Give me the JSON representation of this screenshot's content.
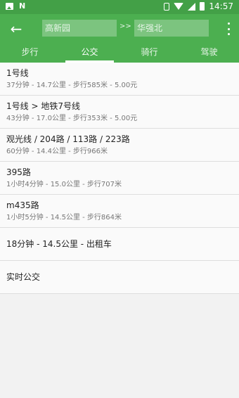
{
  "status_bar": {
    "time": "14:57",
    "icons": [
      "image-icon",
      "n-icon",
      "vibrate-icon",
      "wifi-icon",
      "signal-icon",
      "battery-icon"
    ]
  },
  "toolbar": {
    "from_value": "高新园",
    "arrows": ">>",
    "to_value": "华强北"
  },
  "tabs": [
    {
      "label": "步行",
      "active": false
    },
    {
      "label": "公交",
      "active": true
    },
    {
      "label": "骑行",
      "active": false
    },
    {
      "label": "驾驶",
      "active": false
    }
  ],
  "routes": [
    {
      "title": "1号线",
      "detail": "37分钟 - 14.7公里 - 步行585米 - 5.00元"
    },
    {
      "title": "1号线 > 地铁7号线",
      "detail": "43分钟 - 17.0公里 - 步行353米 - 5.00元"
    },
    {
      "title": "观光线 / 204路 / 113路 / 223路",
      "detail": "60分钟 - 14.4公里 - 步行966米"
    },
    {
      "title": "395路",
      "detail": "1小时4分钟 - 15.0公里 - 步行707米"
    },
    {
      "title": "m435路",
      "detail": "1小时5分钟 - 14.5公里 - 步行864米"
    }
  ],
  "taxi": {
    "title": "18分钟 - 14.5公里 - 出租车"
  },
  "realtime": {
    "title": "实时公交"
  },
  "colors": {
    "status_bar": "#43a047",
    "toolbar": "#4caf50",
    "input": "#7cc47f"
  }
}
